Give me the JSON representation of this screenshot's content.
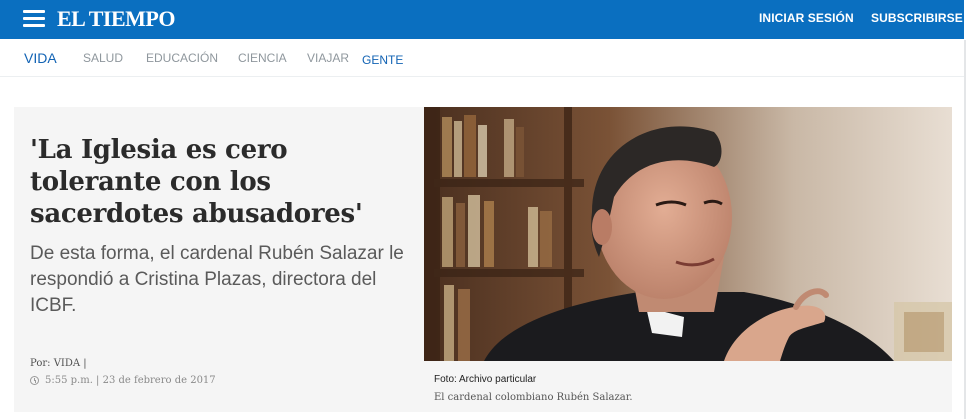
{
  "header": {
    "logo": "EL TIEMPO",
    "login_label": "INICIAR SESIÓN",
    "subscribe_label": "SUBSCRIBIRSE",
    "bar_color": "#0a6fc0"
  },
  "subnav": {
    "section": "VIDA",
    "items": [
      "SALUD",
      "EDUCACIÓN",
      "CIENCIA",
      "VIAJAR",
      "GENTE"
    ],
    "active": "GENTE"
  },
  "article": {
    "headline": "'La Iglesia es cero tolerante con los sacerdotes abusadores'",
    "lead": "De esta forma, el cardenal Rubén Salazar le respondió a Cristina Plazas, directora del ICBF.",
    "byline_prefix": "Por:",
    "byline_author": "VIDA |",
    "date": "5:55 p.m. | 23 de febrero de 2017"
  },
  "photo": {
    "credit": "Foto: Archivo particular",
    "caption": "El cardenal colombiano Rubén Salazar."
  }
}
